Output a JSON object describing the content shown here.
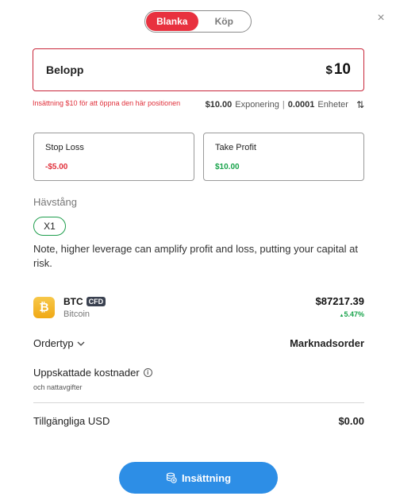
{
  "toggle": {
    "short_label": "Blanka",
    "buy_label": "Köp",
    "active": "short"
  },
  "close_icon": "close-icon",
  "amount": {
    "label": "Belopp",
    "currency_symbol": "$",
    "value": "10"
  },
  "warning": "Insättning $10 för att öppna den här positionen",
  "exposure": {
    "value": "$10.00",
    "label": "Exponering",
    "separator": "|",
    "units_value": "0.0001",
    "units_label": "Enheter",
    "swap_icon": "swap-vertical-icon"
  },
  "stop_loss": {
    "label": "Stop Loss",
    "value": "-$5.00"
  },
  "take_profit": {
    "label": "Take Profit",
    "value": "$10.00"
  },
  "leverage": {
    "label": "Hävstång",
    "value": "X1"
  },
  "note": "Note, higher leverage can amplify profit and loss, putting your capital at risk.",
  "asset": {
    "icon_letter": "₿",
    "symbol": "BTC",
    "badge": "CFD",
    "name": "Bitcoin",
    "price": "$87217.39",
    "change": "5.47%",
    "change_arrow": "▲"
  },
  "order_type": {
    "label": "Ordertyp",
    "value": "Marknadsorder"
  },
  "costs": {
    "label": "Uppskattade kostnader",
    "info_icon": "i",
    "sub": "och nattavgifter"
  },
  "available": {
    "label": "Tillgängliga USD",
    "value": "$0.00"
  },
  "deposit_button": {
    "label": "Insättning"
  },
  "colors": {
    "short": "#e8313f",
    "positive": "#17a34a",
    "button": "#2d8ee6"
  }
}
